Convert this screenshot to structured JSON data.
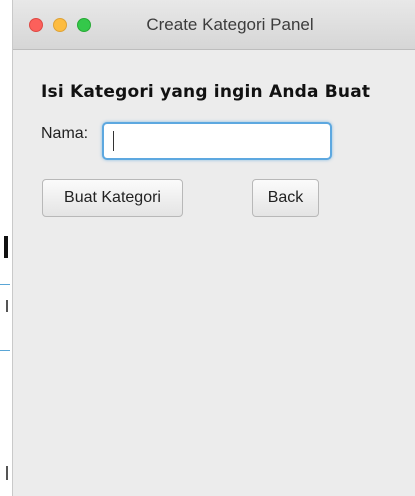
{
  "window": {
    "title": "Create Kategori Panel"
  },
  "form": {
    "heading": "Isi Kategori yang ingin Anda Buat",
    "nama_label": "Nama:",
    "nama_value": "",
    "create_button_label": "Buat Kategori",
    "back_button_label": "Back"
  },
  "colors": {
    "close": "#fc605b",
    "minimize": "#fdbc40",
    "maximize": "#34c84a",
    "focus_ring": "#5da8e0"
  },
  "icons": {
    "close": "close-icon",
    "minimize": "minimize-icon",
    "maximize": "maximize-icon"
  }
}
